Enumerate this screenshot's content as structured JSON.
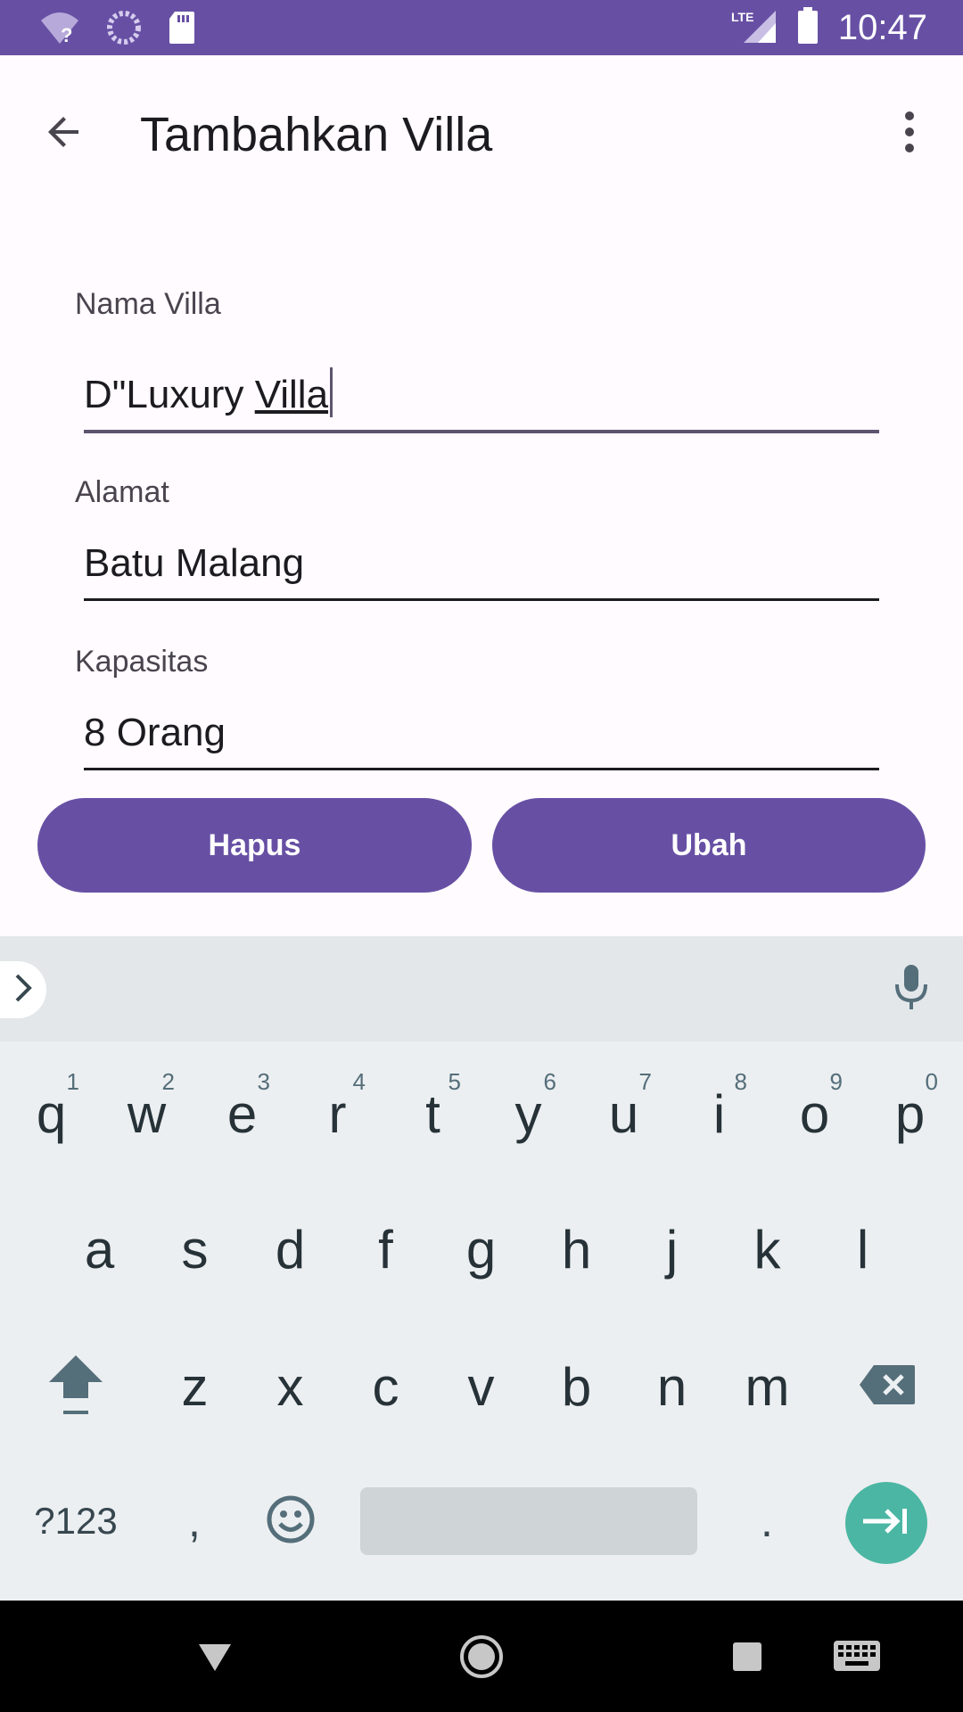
{
  "status_bar": {
    "time": "10:47",
    "network": "LTE",
    "colors": {
      "background": "#6750a4"
    }
  },
  "app_bar": {
    "title": "Tambahkan Villa",
    "back_icon": "arrow-back-icon",
    "menu_icon": "more-vert-icon"
  },
  "form": {
    "nama_villa": {
      "label": "Nama Villa",
      "value_prefix": "D\"Luxury ",
      "value_underlined": "Villa"
    },
    "alamat": {
      "label": "Alamat",
      "value": "Batu Malang"
    },
    "kapasitas": {
      "label": "Kapasitas",
      "value": "8 Orang"
    }
  },
  "buttons": {
    "delete": "Hapus",
    "update": "Ubah",
    "color": "#6750a4"
  },
  "keyboard": {
    "row1": [
      {
        "key": "q",
        "hint": "1"
      },
      {
        "key": "w",
        "hint": "2"
      },
      {
        "key": "e",
        "hint": "3"
      },
      {
        "key": "r",
        "hint": "4"
      },
      {
        "key": "t",
        "hint": "5"
      },
      {
        "key": "y",
        "hint": "6"
      },
      {
        "key": "u",
        "hint": "7"
      },
      {
        "key": "i",
        "hint": "8"
      },
      {
        "key": "o",
        "hint": "9"
      },
      {
        "key": "p",
        "hint": "0"
      }
    ],
    "row2": [
      "a",
      "s",
      "d",
      "f",
      "g",
      "h",
      "j",
      "k",
      "l"
    ],
    "row3": [
      "z",
      "x",
      "c",
      "v",
      "b",
      "n",
      "m"
    ],
    "symbols_label": "?123",
    "comma": ",",
    "period": ".",
    "enter_color": "#4bb6a3"
  }
}
